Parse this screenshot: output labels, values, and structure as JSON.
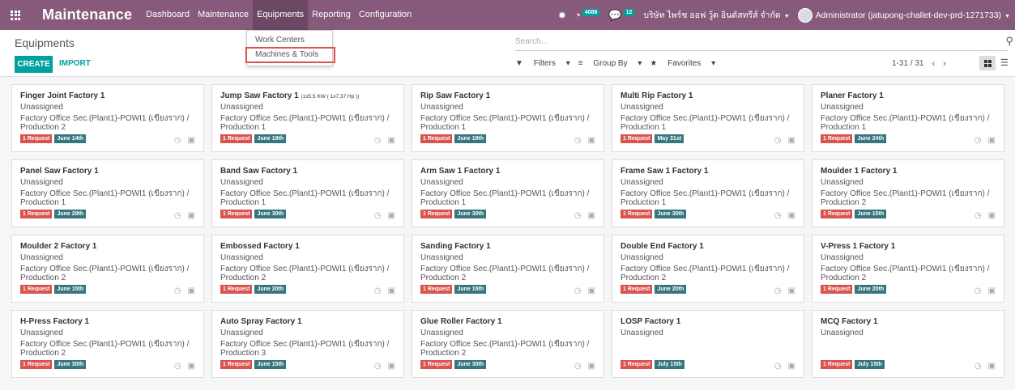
{
  "navbar": {
    "brand": "Maintenance",
    "menu": [
      "Dashboard",
      "Maintenance",
      "Equipments",
      "Reporting",
      "Configuration"
    ],
    "activity_count": "4086",
    "messages_count": "12",
    "company": "บริษัท ไพร์ช ออฟ วู้ด อินดัสทรีส์ จำกัด",
    "user": "Administrator (jatupong-challet-dev-prd-1271733)"
  },
  "dropdown": {
    "items": [
      "Work Centers",
      "Machines & Tools"
    ]
  },
  "control": {
    "breadcrumb": "Equipments",
    "create": "CREATE",
    "import": "IMPORT",
    "search_placeholder": "Search...",
    "filters": "Filters",
    "group_by": "Group By",
    "favorites": "Favorites",
    "pager": "1-31 / 31"
  },
  "cards": [
    {
      "title": "Finger Joint Factory 1",
      "title_small": "",
      "tech": "Unassigned",
      "loc1": "Factory Office Sec.(Plant1)-POWI1 (เขียงราก) /",
      "loc2": "Production 2",
      "request": "1 Request",
      "date": "June 14th"
    },
    {
      "title": "Jump Saw Factory 1",
      "title_small": "(1x5.5 KW ( 1x7.37 Hp ))",
      "tech": "Unassigned",
      "loc1": "Factory Office Sec.(Plant1)-POWI1 (เขียงราก) /",
      "loc2": "Production 1",
      "request": "1 Request",
      "date": "June 19th"
    },
    {
      "title": "Rip Saw Factory 1",
      "title_small": "",
      "tech": "Unassigned",
      "loc1": "Factory Office Sec.(Plant1)-POWI1 (เขียงราก) /",
      "loc2": "Production 1",
      "request": "1 Request",
      "date": "June 19th"
    },
    {
      "title": "Multi Rip Factory 1",
      "title_small": "",
      "tech": "Unassigned",
      "loc1": "Factory Office Sec.(Plant1)-POWI1 (เขียงราก) /",
      "loc2": "Production 1",
      "request": "1 Request",
      "date": "May 31st"
    },
    {
      "title": "Planer Factory 1",
      "title_small": "",
      "tech": "Unassigned",
      "loc1": "Factory Office Sec.(Plant1)-POWI1 (เขียงราก) /",
      "loc2": "Production 1",
      "request": "1 Request",
      "date": "June 24th"
    },
    {
      "title": "Panel Saw Factory 1",
      "title_small": "",
      "tech": "Unassigned",
      "loc1": "Factory Office Sec.(Plant1)-POWI1 (เขียงราก) /",
      "loc2": "Production 1",
      "request": "1 Request",
      "date": "June 29th"
    },
    {
      "title": "Band Saw Factory 1",
      "title_small": "",
      "tech": "Unassigned",
      "loc1": "Factory Office Sec.(Plant1)-POWI1 (เขียงราก) /",
      "loc2": "Production 1",
      "request": "1 Request",
      "date": "June 30th"
    },
    {
      "title": "Arm Saw 1 Factory 1",
      "title_small": "",
      "tech": "Unassigned",
      "loc1": "Factory Office Sec.(Plant1)-POWI1 (เขียงราก) /",
      "loc2": "Production 1",
      "request": "1 Request",
      "date": "June 30th"
    },
    {
      "title": "Frame Saw 1 Factory 1",
      "title_small": "",
      "tech": "Unassigned",
      "loc1": "Factory Office Sec.(Plant1)-POWI1 (เขียงราก) /",
      "loc2": "Production 1",
      "request": "1 Request",
      "date": "June 30th"
    },
    {
      "title": "Moulder 1 Factory 1",
      "title_small": "",
      "tech": "Unassigned",
      "loc1": "Factory Office Sec.(Plant1)-POWI1 (เขียงราก) /",
      "loc2": "Production 2",
      "request": "1 Request",
      "date": "June 15th"
    },
    {
      "title": "Moulder 2 Factory 1",
      "title_small": "",
      "tech": "Unassigned",
      "loc1": "Factory Office Sec.(Plant1)-POWI1 (เขียงราก) /",
      "loc2": "Production 2",
      "request": "1 Request",
      "date": "June 15th"
    },
    {
      "title": "Embossed Factory 1",
      "title_small": "",
      "tech": "Unassigned",
      "loc1": "Factory Office Sec.(Plant1)-POWI1 (เขียงราก) /",
      "loc2": "Production 2",
      "request": "1 Request",
      "date": "June 20th"
    },
    {
      "title": "Sanding Factory 1",
      "title_small": "",
      "tech": "Unassigned",
      "loc1": "Factory Office Sec.(Plant1)-POWI1 (เขียงราก) /",
      "loc2": "Production 2",
      "request": "1 Request",
      "date": "June 15th"
    },
    {
      "title": "Double End Factory 1",
      "title_small": "",
      "tech": "Unassigned",
      "loc1": "Factory Office Sec.(Plant1)-POWI1 (เขียงราก) /",
      "loc2": "Production 2",
      "request": "1 Request",
      "date": "June 20th"
    },
    {
      "title": "V-Press 1 Factory 1",
      "title_small": "",
      "tech": "Unassigned",
      "loc1": "Factory Office Sec.(Plant1)-POWI1 (เขียงราก) /",
      "loc2": "Production 2",
      "request": "1 Request",
      "date": "June 20th"
    },
    {
      "title": "H-Press Factory 1",
      "title_small": "",
      "tech": "Unassigned",
      "loc1": "Factory Office Sec.(Plant1)-POWI1 (เขียงราก) /",
      "loc2": "Production 2",
      "request": "1 Request",
      "date": "June 30th"
    },
    {
      "title": "Auto Spray Factory 1",
      "title_small": "",
      "tech": "Unassigned",
      "loc1": "Factory Office Sec.(Plant1)-POWI1 (เขียงราก) /",
      "loc2": "Production 3",
      "request": "1 Request",
      "date": "June 15th"
    },
    {
      "title": "Glue Roller Factory 1",
      "title_small": "",
      "tech": "Unassigned",
      "loc1": "Factory Office Sec.(Plant1)-POWI1 (เขียงราก) /",
      "loc2": "Production 2",
      "request": "1 Request",
      "date": "June 30th"
    },
    {
      "title": "LOSP Factory 1",
      "title_small": "",
      "tech": "Unassigned",
      "loc1": "",
      "loc2": "",
      "request": "1 Request",
      "date": "July 15th"
    },
    {
      "title": "MCQ Factory 1",
      "title_small": "",
      "tech": "Unassigned",
      "loc1": "",
      "loc2": "",
      "request": "1 Request",
      "date": "July 15th"
    }
  ]
}
